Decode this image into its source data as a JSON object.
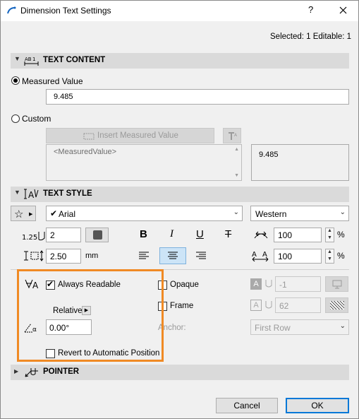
{
  "dialog": {
    "title": "Dimension Text Settings",
    "help_label": "?",
    "close_label": "X",
    "selection_info": "Selected: 1 Editable: 1"
  },
  "text_content": {
    "section_title": "TEXT CONTENT",
    "measured_value_label": "Measured Value",
    "measured_value": "9.485",
    "custom_label": "Custom",
    "insert_button_label": "Insert Measured Value",
    "custom_text": "<MeasuredValue>",
    "preview_value": "9.485"
  },
  "text_style": {
    "section_title": "TEXT STYLE",
    "font_name": "Arial",
    "script_name": "Western",
    "font_size": "2",
    "pen_offset": "2.50",
    "pen_unit": "mm",
    "width_factor": "100",
    "spacing_factor": "100",
    "percent": "%",
    "bold": "B",
    "italic": "I",
    "underline": "U",
    "strike": "T",
    "size_label": "1.25"
  },
  "placement": {
    "always_readable_label": "Always Readable",
    "always_readable_checked": true,
    "relative_label": "Relative",
    "angle_value": "0.00°",
    "revert_label": "Revert to Automatic Position",
    "opaque_label": "Opaque",
    "frame_label": "Frame",
    "opaque_pen_value": "-1",
    "frame_pen_value": "62",
    "anchor_label": "Anchor:",
    "anchor_value": "First Row"
  },
  "pointer": {
    "section_title": "POINTER"
  },
  "footer": {
    "cancel_label": "Cancel",
    "ok_label": "OK"
  },
  "colors": {
    "highlight_box": "#f08a24",
    "ok_border": "#0078d7",
    "selected_align": "#cce4f7"
  }
}
